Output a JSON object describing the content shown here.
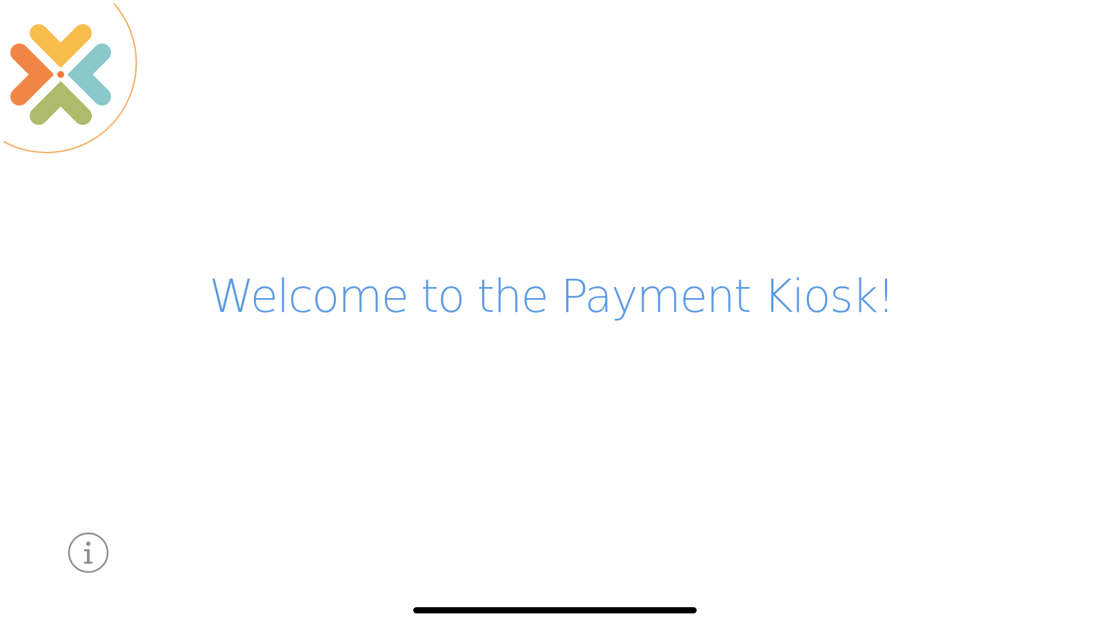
{
  "screen": {
    "welcome_text": "Welcome to the Payment Kiosk!"
  },
  "logo": {
    "icon": "brand-cross-logo",
    "ring_color": "#F5B26B",
    "colors": {
      "top": "#F9B63A",
      "left": "#F07A30",
      "right": "#7EC3C4",
      "bottom": "#A5B45A",
      "center": "#F07A30"
    }
  },
  "info": {
    "icon": "info-icon",
    "color": "#8F8F8F"
  },
  "colors": {
    "welcome_text": "#5B9BE3",
    "home_indicator": "#000000",
    "background": "#FFFFFF"
  }
}
